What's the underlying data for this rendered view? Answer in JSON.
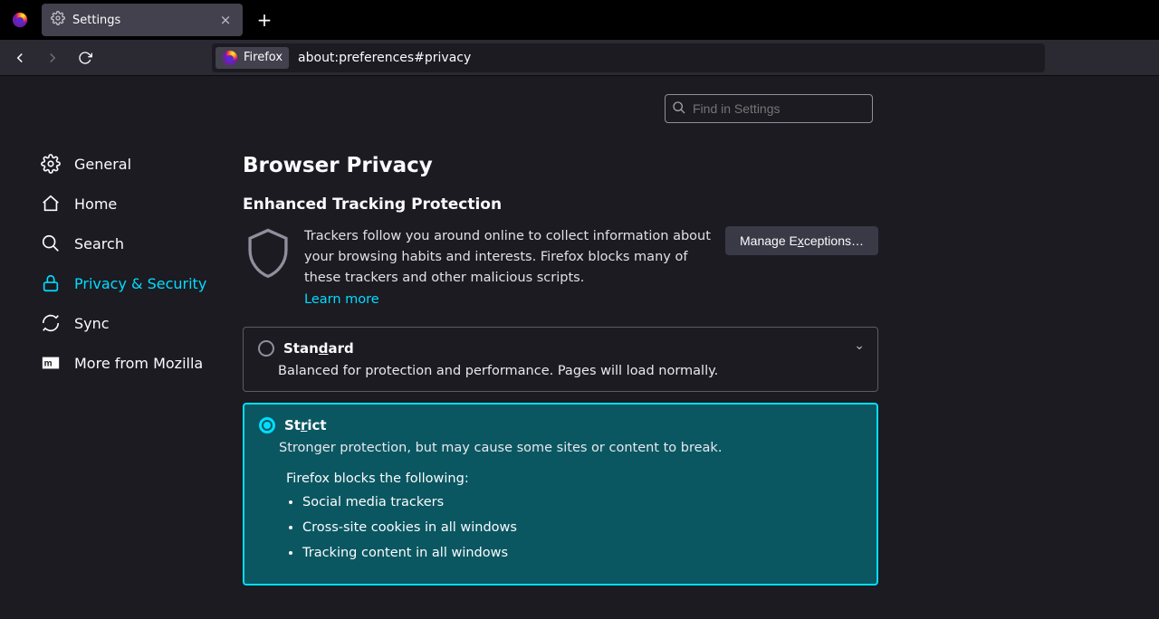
{
  "window": {
    "tab_title": "Settings",
    "url_badge": "Firefox",
    "url_path": "about:preferences#privacy"
  },
  "search": {
    "placeholder": "Find in Settings"
  },
  "sidebar": {
    "items": [
      {
        "label": "General"
      },
      {
        "label": "Home"
      },
      {
        "label": "Search"
      },
      {
        "label": "Privacy & Security"
      },
      {
        "label": "Sync"
      },
      {
        "label": "More from Mozilla"
      }
    ]
  },
  "page": {
    "title": "Browser Privacy",
    "section_title": "Enhanced Tracking Protection",
    "etp_desc": "Trackers follow you around online to collect information about your browsing habits and interests. Firefox blocks many of these trackers and other malicious scripts.",
    "learn_more": "Learn more",
    "manage_exceptions_pre": "Manage E",
    "manage_exceptions_key": "x",
    "manage_exceptions_post": "ceptions…",
    "standard": {
      "label_pre": "Stan",
      "label_key": "d",
      "label_post": "ard",
      "desc": "Balanced for protection and performance. Pages will load normally."
    },
    "strict": {
      "label_pre": "St",
      "label_key": "r",
      "label_post": "ict",
      "desc": "Stronger protection, but may cause some sites or content to break.",
      "blocks_label": "Firefox blocks the following:",
      "blocks": [
        "Social media trackers",
        "Cross-site cookies in all windows",
        "Tracking content in all windows"
      ]
    }
  }
}
